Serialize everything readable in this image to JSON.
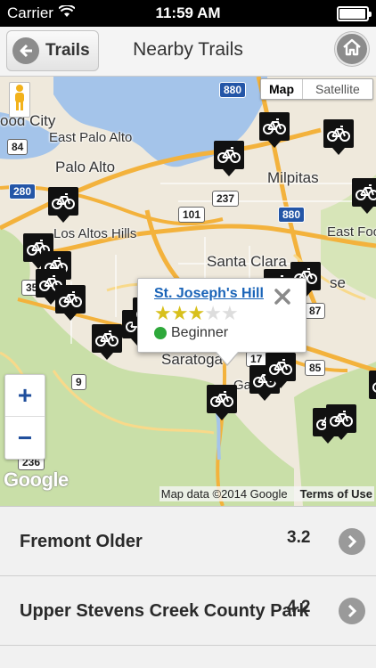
{
  "status_bar": {
    "carrier": "Carrier",
    "time": "11:59 AM",
    "battery_level": 0.95
  },
  "nav": {
    "back_label": "Trails",
    "title": "Nearby Trails"
  },
  "map": {
    "type_toggle": {
      "map": "Map",
      "satellite": "Satellite",
      "selected": "Map"
    },
    "labels": {
      "redwood_city": "ood City",
      "east_palo_alto": "East Palo Alto",
      "palo_alto": "Palo Alto",
      "milpitas": "Milpitas",
      "los_altos_hills": "Los Altos Hills",
      "santa_clara": "Santa Clara",
      "east_foothills": "East Foo",
      "saratoga": "Saratoga",
      "san_jose_fragment": "se",
      "los_gatos_fragment": "Ga"
    },
    "shields": {
      "r880a": "880",
      "r84": "84",
      "r280": "280",
      "r237": "237",
      "r101": "101",
      "r880b": "880",
      "r35": "35",
      "r87": "87",
      "r17": "17",
      "r85": "85",
      "r9": "9",
      "r236": "236"
    },
    "zoom_in": "+",
    "zoom_out": "−",
    "google_logo": "Google",
    "attribution": "Map data ©2014 Google",
    "terms": "Terms of Use",
    "popup": {
      "trail_name": "St. Joseph's Hill",
      "rating": 3,
      "rating_max": 5,
      "level": "Beginner",
      "level_color": "#2ea83a"
    }
  },
  "trails": [
    {
      "name": "Fremont Older",
      "distance": "3.2"
    },
    {
      "name": "Upper Stevens Creek County Park",
      "distance": "4.2"
    }
  ],
  "colors": {
    "water": "#a4c4ea",
    "green": "#c9dfa8",
    "highway": "#f3b23c",
    "link": "#1a64b8"
  }
}
